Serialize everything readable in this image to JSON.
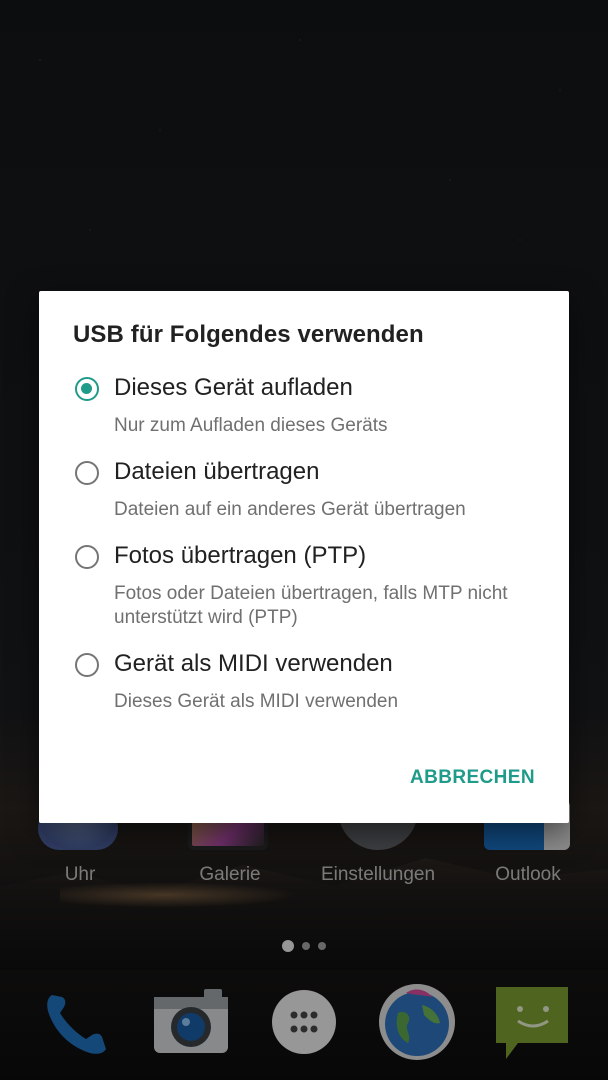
{
  "dialog": {
    "title": "USB für Folgendes verwenden",
    "options": [
      {
        "label": "Dieses Gerät aufladen",
        "description": "Nur zum Aufladen dieses Geräts",
        "selected": true
      },
      {
        "label": "Dateien übertragen",
        "description": "Dateien auf ein anderes Gerät übertragen",
        "selected": false
      },
      {
        "label": "Fotos übertragen (PTP)",
        "description": "Fotos oder Dateien übertragen, falls MTP nicht unterstützt wird (PTP)",
        "selected": false
      },
      {
        "label": "Gerät als MIDI verwenden",
        "description": "Dieses Gerät als MIDI verwenden",
        "selected": false
      }
    ],
    "cancel_label": "ABBRECHEN"
  },
  "home": {
    "apps": [
      {
        "label": "Uhr",
        "icon": "clock-icon"
      },
      {
        "label": "Galerie",
        "icon": "gallery-icon"
      },
      {
        "label": "Einstellungen",
        "icon": "settings-icon"
      },
      {
        "label": "Outlook",
        "icon": "outlook-icon"
      }
    ],
    "page_indicator": {
      "pages": 3,
      "current": 1
    },
    "dock": [
      {
        "icon": "phone-icon"
      },
      {
        "icon": "camera-icon"
      },
      {
        "icon": "app-drawer-icon"
      },
      {
        "icon": "browser-globe-icon"
      },
      {
        "icon": "messaging-icon"
      }
    ]
  },
  "colors": {
    "accent": "#1f9b8a"
  }
}
